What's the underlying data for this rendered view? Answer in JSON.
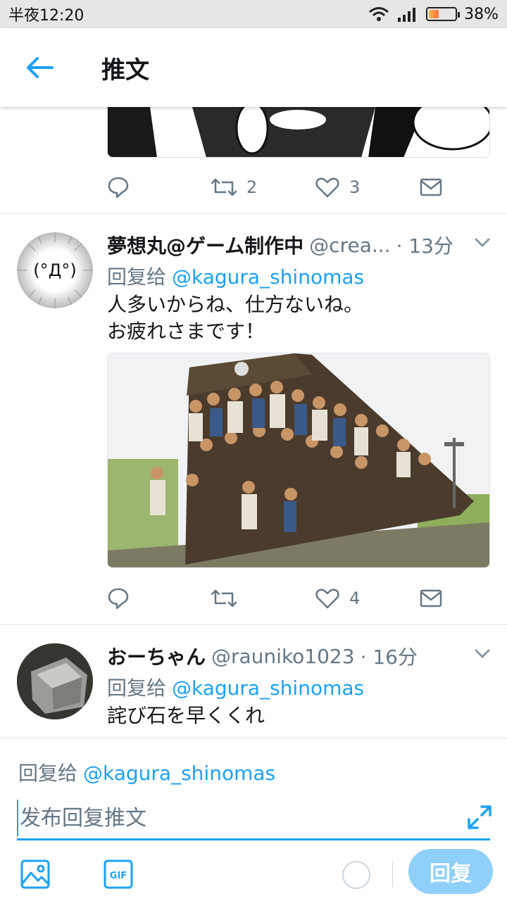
{
  "status_bar": {
    "time": "半夜12:20",
    "battery": "38%",
    "battery_level": 0.38
  },
  "header": {
    "title": "推文"
  },
  "tweets": [
    {
      "actions": {
        "reply_count": "",
        "retweet_count": "2",
        "like_count": "3"
      }
    },
    {
      "avatar_text": "(°Д°)",
      "name": "夢想丸@ゲーム制作中",
      "handle": "@crea...",
      "time": "· 13分",
      "reply_label": "回复给",
      "reply_to": "@kagura_shinomas",
      "text": "人多いからね、仕方ないね。\nお疲れさまです！",
      "actions": {
        "reply_count": "",
        "retweet_count": "",
        "like_count": "4"
      }
    },
    {
      "name": "おーちゃん",
      "handle": "@rauniko1023",
      "time": "· 16分",
      "reply_label": "回复给",
      "reply_to": "@kagura_shinomas",
      "text": "詫び石を早くくれ"
    }
  ],
  "composer": {
    "reply_label": "回复给",
    "reply_to": "@kagura_shinomas",
    "placeholder": "发布回复推文",
    "gif_label": "GIF",
    "reply_button": "回复"
  },
  "colors": {
    "accent": "#1da1f2",
    "muted": "#657786",
    "reply_button_disabled": "#8ed0f9"
  }
}
